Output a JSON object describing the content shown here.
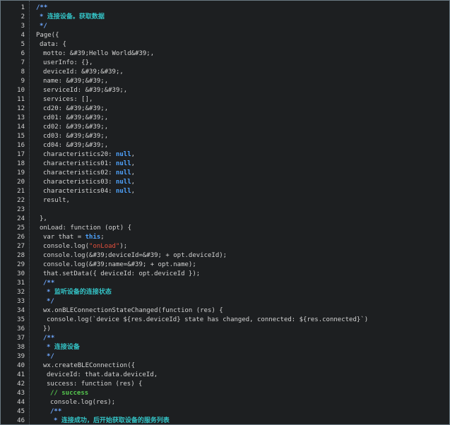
{
  "editor": {
    "lines": [
      {
        "n": "1",
        "indent": 0,
        "tokens": [
          {
            "t": "/**",
            "c": "comment"
          }
        ]
      },
      {
        "n": "2",
        "indent": 1,
        "tokens": [
          {
            "t": "* ",
            "c": "comment"
          },
          {
            "t": "连接设备。获取数据",
            "c": "cjk"
          }
        ]
      },
      {
        "n": "3",
        "indent": 1,
        "tokens": [
          {
            "t": "*/",
            "c": "comment"
          }
        ]
      },
      {
        "n": "4",
        "indent": 0,
        "tokens": [
          {
            "t": "Page({",
            "c": "plain"
          }
        ]
      },
      {
        "n": "5",
        "indent": 1,
        "tokens": [
          {
            "t": "data: {",
            "c": "plain"
          }
        ]
      },
      {
        "n": "6",
        "indent": 2,
        "tokens": [
          {
            "t": "motto: &#39;Hello World&#39;,",
            "c": "plain"
          }
        ]
      },
      {
        "n": "7",
        "indent": 2,
        "tokens": [
          {
            "t": "userInfo: {},",
            "c": "plain"
          }
        ]
      },
      {
        "n": "8",
        "indent": 2,
        "tokens": [
          {
            "t": "deviceId: &#39;&#39;,",
            "c": "plain"
          }
        ]
      },
      {
        "n": "9",
        "indent": 2,
        "tokens": [
          {
            "t": "name: &#39;&#39;,",
            "c": "plain"
          }
        ]
      },
      {
        "n": "10",
        "indent": 2,
        "tokens": [
          {
            "t": "serviceId: &#39;&#39;,",
            "c": "plain"
          }
        ]
      },
      {
        "n": "11",
        "indent": 2,
        "tokens": [
          {
            "t": "services: [],",
            "c": "plain"
          }
        ]
      },
      {
        "n": "12",
        "indent": 2,
        "tokens": [
          {
            "t": "cd20: &#39;&#39;,",
            "c": "plain"
          }
        ]
      },
      {
        "n": "13",
        "indent": 2,
        "tokens": [
          {
            "t": "cd01: &#39;&#39;,",
            "c": "plain"
          }
        ]
      },
      {
        "n": "14",
        "indent": 2,
        "tokens": [
          {
            "t": "cd02: &#39;&#39;,",
            "c": "plain"
          }
        ]
      },
      {
        "n": "15",
        "indent": 2,
        "tokens": [
          {
            "t": "cd03: &#39;&#39;,",
            "c": "plain"
          }
        ]
      },
      {
        "n": "16",
        "indent": 2,
        "tokens": [
          {
            "t": "cd04: &#39;&#39;,",
            "c": "plain"
          }
        ]
      },
      {
        "n": "17",
        "indent": 2,
        "tokens": [
          {
            "t": "characteristics20: ",
            "c": "plain"
          },
          {
            "t": "null",
            "c": "kw"
          },
          {
            "t": ",",
            "c": "plain"
          }
        ]
      },
      {
        "n": "18",
        "indent": 2,
        "tokens": [
          {
            "t": "characteristics01: ",
            "c": "plain"
          },
          {
            "t": "null",
            "c": "kw"
          },
          {
            "t": ",",
            "c": "plain"
          }
        ]
      },
      {
        "n": "19",
        "indent": 2,
        "tokens": [
          {
            "t": "characteristics02: ",
            "c": "plain"
          },
          {
            "t": "null",
            "c": "kw"
          },
          {
            "t": ",",
            "c": "plain"
          }
        ]
      },
      {
        "n": "20",
        "indent": 2,
        "tokens": [
          {
            "t": "characteristics03: ",
            "c": "plain"
          },
          {
            "t": "null",
            "c": "kw"
          },
          {
            "t": ",",
            "c": "plain"
          }
        ]
      },
      {
        "n": "21",
        "indent": 2,
        "tokens": [
          {
            "t": "characteristics04: ",
            "c": "plain"
          },
          {
            "t": "null",
            "c": "kw"
          },
          {
            "t": ",",
            "c": "plain"
          }
        ]
      },
      {
        "n": "22",
        "indent": 2,
        "tokens": [
          {
            "t": "result,",
            "c": "plain"
          }
        ]
      },
      {
        "n": "23",
        "indent": 0,
        "tokens": []
      },
      {
        "n": "24",
        "indent": 1,
        "tokens": [
          {
            "t": "},",
            "c": "plain"
          }
        ]
      },
      {
        "n": "25",
        "indent": 1,
        "tokens": [
          {
            "t": "onLoad: function (opt) {",
            "c": "plain"
          }
        ]
      },
      {
        "n": "26",
        "indent": 2,
        "tokens": [
          {
            "t": "var that = ",
            "c": "plain"
          },
          {
            "t": "this",
            "c": "kw"
          },
          {
            "t": ";",
            "c": "plain"
          }
        ]
      },
      {
        "n": "27",
        "indent": 2,
        "tokens": [
          {
            "t": "console.log(",
            "c": "plain"
          },
          {
            "t": "\"onLoad\"",
            "c": "str"
          },
          {
            "t": ");",
            "c": "plain"
          }
        ]
      },
      {
        "n": "28",
        "indent": 2,
        "tokens": [
          {
            "t": "console.log(&#39;deviceId=&#39; + opt.deviceId);",
            "c": "plain"
          }
        ]
      },
      {
        "n": "29",
        "indent": 2,
        "tokens": [
          {
            "t": "console.log(&#39;name=&#39; + opt.name);",
            "c": "plain"
          }
        ]
      },
      {
        "n": "30",
        "indent": 2,
        "tokens": [
          {
            "t": "that.setData({ deviceId: opt.deviceId });",
            "c": "plain"
          }
        ]
      },
      {
        "n": "31",
        "indent": 2,
        "tokens": [
          {
            "t": "/**",
            "c": "comment"
          }
        ]
      },
      {
        "n": "32",
        "indent": 3,
        "tokens": [
          {
            "t": "* ",
            "c": "comment"
          },
          {
            "t": "监听设备的连接状态",
            "c": "cjk"
          }
        ]
      },
      {
        "n": "33",
        "indent": 3,
        "tokens": [
          {
            "t": "*/",
            "c": "comment"
          }
        ]
      },
      {
        "n": "34",
        "indent": 2,
        "tokens": [
          {
            "t": "wx.onBLEConnectionStateChanged(function (res) {",
            "c": "plain"
          }
        ]
      },
      {
        "n": "35",
        "indent": 3,
        "tokens": [
          {
            "t": "console.log(`device ${res.deviceId} state has changed, connected: ${res.connected}`)",
            "c": "plain"
          }
        ]
      },
      {
        "n": "36",
        "indent": 2,
        "tokens": [
          {
            "t": "})",
            "c": "plain"
          }
        ]
      },
      {
        "n": "37",
        "indent": 2,
        "tokens": [
          {
            "t": "/**",
            "c": "comment"
          }
        ]
      },
      {
        "n": "38",
        "indent": 3,
        "tokens": [
          {
            "t": "* ",
            "c": "comment"
          },
          {
            "t": "连接设备",
            "c": "cjk"
          }
        ]
      },
      {
        "n": "39",
        "indent": 3,
        "tokens": [
          {
            "t": "*/",
            "c": "comment"
          }
        ]
      },
      {
        "n": "40",
        "indent": 2,
        "tokens": [
          {
            "t": "wx.createBLEConnection({",
            "c": "plain"
          }
        ]
      },
      {
        "n": "41",
        "indent": 3,
        "tokens": [
          {
            "t": "deviceId: that.data.deviceId,",
            "c": "plain"
          }
        ]
      },
      {
        "n": "42",
        "indent": 3,
        "tokens": [
          {
            "t": "success: function (res) {",
            "c": "plain"
          }
        ]
      },
      {
        "n": "43",
        "indent": 4,
        "tokens": [
          {
            "t": "// success",
            "c": "green"
          }
        ]
      },
      {
        "n": "44",
        "indent": 4,
        "tokens": [
          {
            "t": "console.log(res);",
            "c": "plain"
          }
        ]
      },
      {
        "n": "45",
        "indent": 4,
        "tokens": [
          {
            "t": "/**",
            "c": "comment"
          }
        ]
      },
      {
        "n": "46",
        "indent": 5,
        "tokens": [
          {
            "t": "* ",
            "c": "comment"
          },
          {
            "t": "连接成功，后开始获取设备的服务列表",
            "c": "cjk"
          }
        ]
      }
    ]
  }
}
